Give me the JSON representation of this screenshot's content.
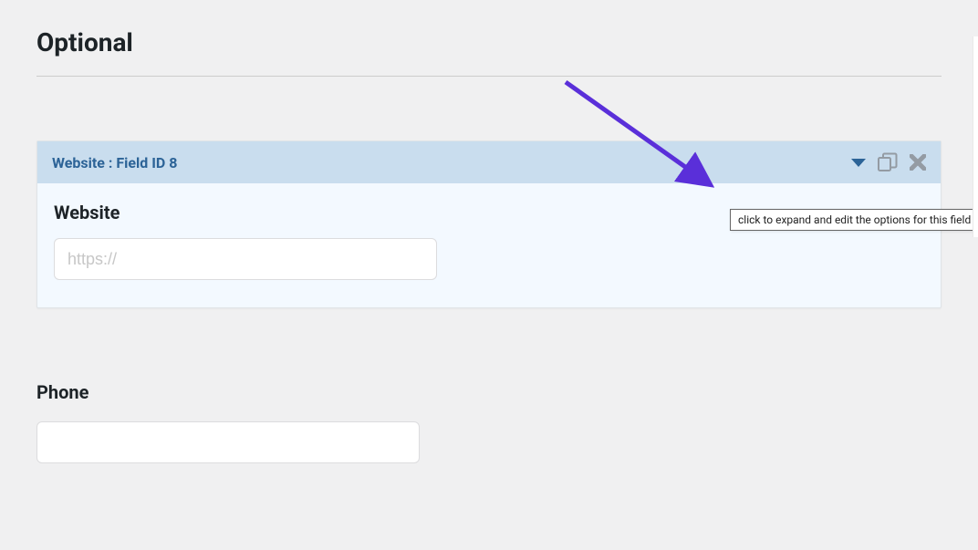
{
  "section": {
    "title": "Optional"
  },
  "field_card": {
    "header_title": "Website : Field ID 8",
    "label": "Website",
    "placeholder": "https://"
  },
  "plain_field": {
    "label": "Phone"
  },
  "tooltip": {
    "text": "click to expand and edit the options for this field"
  }
}
